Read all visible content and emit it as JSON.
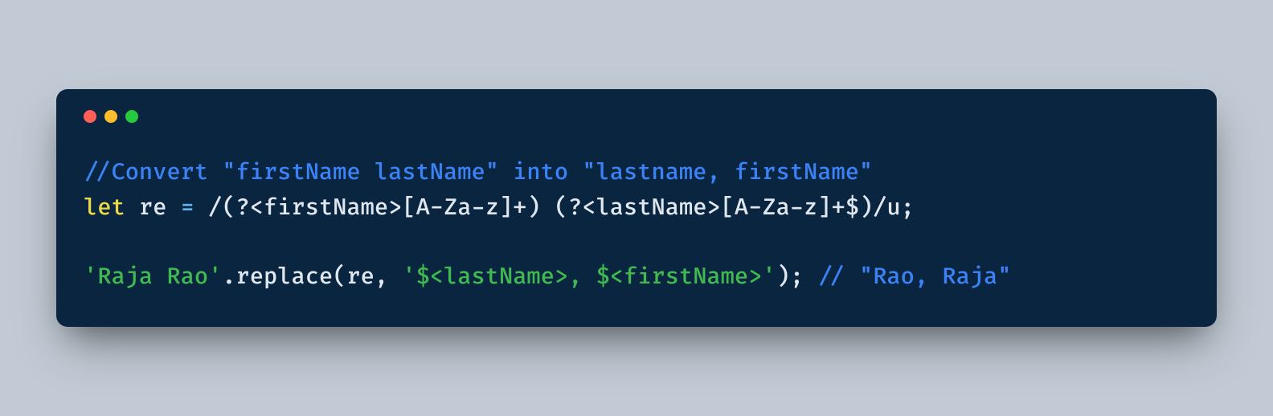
{
  "code": {
    "line1": {
      "comment": "//Convert \"firstName lastName\" into \"lastname, firstName\""
    },
    "line2": {
      "keyword": "let",
      "space1": " ",
      "ident": "re",
      "space2": " ",
      "op_eq": "=",
      "space3": " ",
      "regex": "/(?<firstName>[A-Za-z]+) (?<lastName>[A-Za-z]+$)/u",
      "semi": ";"
    },
    "blank": "",
    "line3": {
      "str1": "'Raja Rao'",
      "dot": ".",
      "method": "replace",
      "lparen": "(",
      "arg1": "re",
      "comma": ", ",
      "str2": "'$<lastName>, $<firstName>'",
      "rparen": ")",
      "semi": ";",
      "space": " ",
      "comment": "// \"Rao, Raja\""
    }
  },
  "traffic_lights": {
    "red": "#ff5f56",
    "yellow": "#ffbd2e",
    "green": "#27c93f"
  }
}
